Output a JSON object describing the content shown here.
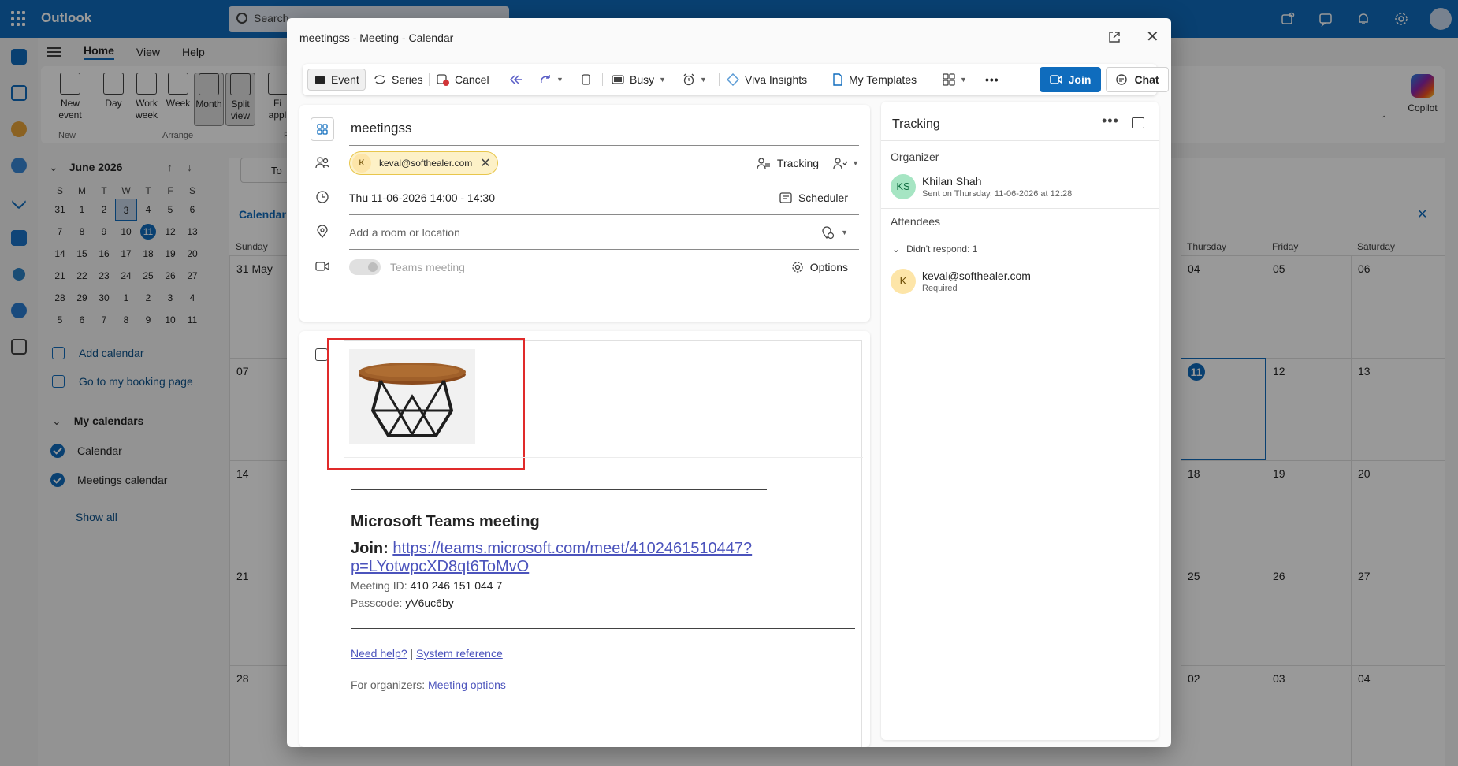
{
  "app": {
    "name": "Outlook",
    "search_placeholder": "Search"
  },
  "ribbon": {
    "tabs": [
      "Home",
      "View",
      "Help"
    ],
    "buttons": {
      "new_event": "New event",
      "day": "Day",
      "work_week": "Work week",
      "week": "Week",
      "month": "Month",
      "split_view": "Split view",
      "filter_applied": "Fi appl"
    },
    "groups": {
      "new": "New",
      "arrange": "Arrange",
      "filter": "Fi"
    },
    "copilot": "Copilot"
  },
  "minical": {
    "month_label": "June 2026",
    "weekdays": [
      "S",
      "M",
      "T",
      "W",
      "T",
      "F",
      "S"
    ],
    "weeks": [
      [
        "31",
        "1",
        "2",
        "3",
        "4",
        "5",
        "6"
      ],
      [
        "7",
        "8",
        "9",
        "10",
        "11",
        "12",
        "13"
      ],
      [
        "14",
        "15",
        "16",
        "17",
        "18",
        "19",
        "20"
      ],
      [
        "21",
        "22",
        "23",
        "24",
        "25",
        "26",
        "27"
      ],
      [
        "28",
        "29",
        "30",
        "1",
        "2",
        "3",
        "4"
      ],
      [
        "5",
        "6",
        "7",
        "8",
        "9",
        "10",
        "11"
      ]
    ],
    "selected_day": "3",
    "today": "11"
  },
  "sidebar": {
    "add_calendar": "Add calendar",
    "booking_page": "Go to my booking page",
    "my_calendars": "My calendars",
    "calendars": [
      "Calendar",
      "Meetings calendar"
    ],
    "show_all": "Show all"
  },
  "main": {
    "today_button": "To",
    "calendar_title": "Calendar",
    "day_headers": [
      "Sunday",
      "Thursday",
      "Friday",
      "Saturday"
    ],
    "rows": [
      [
        "31 May",
        "04",
        "05",
        "06"
      ],
      [
        "07",
        "11",
        "12",
        "13"
      ],
      [
        "14",
        "18",
        "19",
        "20"
      ],
      [
        "21",
        "25",
        "26",
        "27"
      ],
      [
        "28",
        "02",
        "03",
        "04"
      ]
    ]
  },
  "dialog": {
    "window_title": "meetingss - Meeting - Calendar",
    "toolbar": {
      "event": "Event",
      "series": "Series",
      "cancel": "Cancel",
      "busy": "Busy",
      "viva": "Viva Insights",
      "templates": "My Templates",
      "join": "Join",
      "chat": "Chat"
    },
    "form": {
      "title": "meetingss",
      "attendee_initial": "K",
      "attendee_email": "keval@softhealer.com",
      "tracking_btn": "Tracking",
      "datetime": "Thu 11-06-2026 14:00 - 14:30",
      "scheduler_btn": "Scheduler",
      "location_placeholder": "Add a room or location",
      "teams_label": "Teams meeting",
      "options_btn": "Options"
    },
    "body": {
      "teams_heading": "Microsoft Teams meeting",
      "join_label": "Join:",
      "join_url_line1": "https://teams.microsoft.com/meet/4102461510447?",
      "join_url_line2": "p=LYotwpcXD8qt6ToMvO",
      "meeting_id_label": "Meeting ID:",
      "meeting_id": "410 246 151 044 7",
      "passcode_label": "Passcode:",
      "passcode": "yV6uc6by",
      "need_help": "Need help?",
      "pipe": "|",
      "system_reference": "System reference",
      "organizers_label": "For organizers:",
      "meeting_options": "Meeting options"
    },
    "tracking": {
      "header": "Tracking",
      "organizer_label": "Organizer",
      "organizer_initials": "KS",
      "organizer_name": "Khilan Shah",
      "organizer_sent": "Sent on Thursday, 11-06-2026 at 12:28",
      "attendees_label": "Attendees",
      "didnt_respond": "Didn't respond: 1",
      "attendee_initial": "K",
      "attendee_email": "keval@softhealer.com",
      "attendee_role": "Required"
    }
  },
  "colors": {
    "brand": "#0f6cbd",
    "link": "#4b53bc",
    "selection_border": "#e02a2a",
    "attendee_chip": "#fdf1c7"
  }
}
